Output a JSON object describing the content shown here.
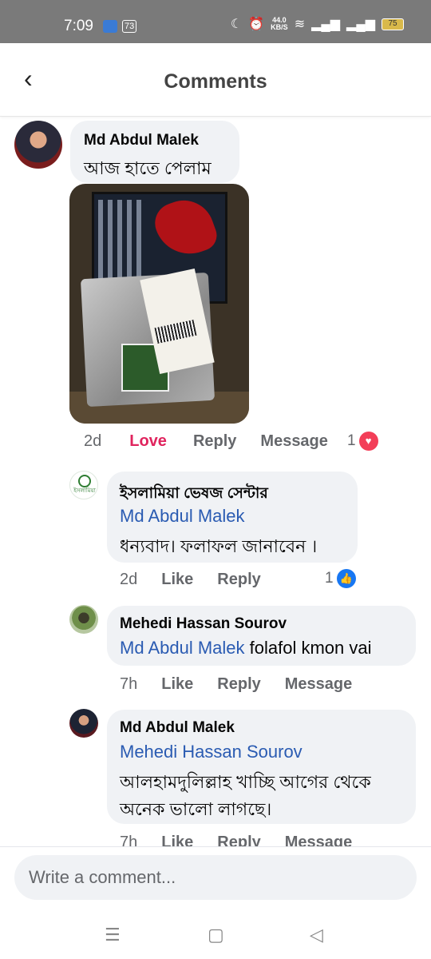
{
  "status": {
    "time": "7:09",
    "notif_count": "73",
    "speed_value": "44.0",
    "speed_unit": "KB/S",
    "battery": "75"
  },
  "header": {
    "back_icon": "chevron-left-icon",
    "title": "Comments"
  },
  "comments": [
    {
      "author": "Md Abdul Malek",
      "text": "আজ হাতে পেলাম",
      "has_photo": true,
      "time": "2d",
      "love_label": "Love",
      "reply_label": "Reply",
      "message_label": "Message",
      "reaction_count": "1",
      "reaction_icon": "heart-icon"
    },
    {
      "author": "ইসলামিয়া ভেষজ সেন্টার",
      "avatar_text": "ইসলামিয়া",
      "mention": "Md Abdul Malek",
      "text": "ধন্যবাদ। ফলাফল জানাবেন ।",
      "time": "2d",
      "like_label": "Like",
      "reply_label": "Reply",
      "reaction_count": "1",
      "reaction_icon": "thumbs-up-icon"
    },
    {
      "author": "Mehedi Hassan Sourov",
      "mention": "Md Abdul Malek",
      "text": " folafol kmon vai",
      "time": "7h",
      "like_label": "Like",
      "reply_label": "Reply",
      "message_label": "Message"
    },
    {
      "author": "Md Abdul Malek",
      "mention": "Mehedi Hassan Sourov",
      "text_line1": "আলহামদুলিল্লাহ খাচ্ছি আগের থেকে",
      "text_line2": "অনেক ভালো লাগছে।",
      "time": "7h",
      "like_label": "Like",
      "reply_label": "Reply",
      "message_label": "Message"
    }
  ],
  "composer": {
    "placeholder": "Write a comment..."
  },
  "colors": {
    "bubble": "#f0f2f5",
    "mention": "#2a5bb2",
    "love": "#e0245e",
    "like": "#1877f2"
  }
}
